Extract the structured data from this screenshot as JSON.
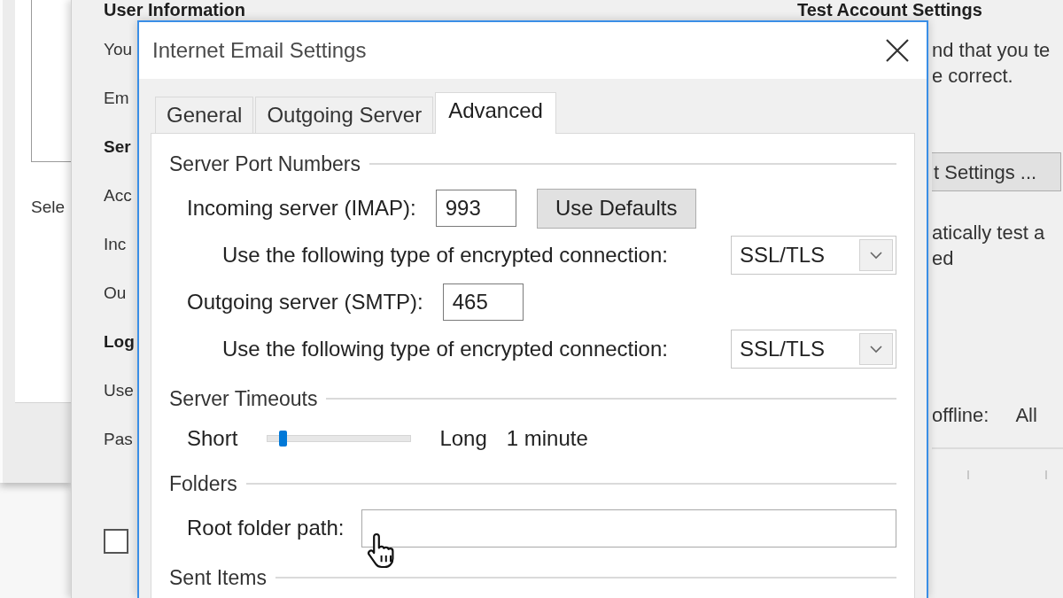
{
  "left_window": {
    "label": "Sele"
  },
  "account_window": {
    "left_column": [
      {
        "kind": "heading",
        "text": "User Information"
      },
      {
        "kind": "label",
        "text": "You"
      },
      {
        "kind": "label",
        "text": "Em"
      },
      {
        "kind": "heading",
        "text": "Ser"
      },
      {
        "kind": "label",
        "text": "Acc"
      },
      {
        "kind": "label",
        "text": "Inc"
      },
      {
        "kind": "label",
        "text": "Ou"
      },
      {
        "kind": "heading",
        "text": "Log"
      },
      {
        "kind": "label",
        "text": "Use"
      },
      {
        "kind": "label",
        "text": "Pas"
      }
    ],
    "checkbox": {
      "checked": false
    },
    "right_column": {
      "heading": "Test Account Settings",
      "lines": [
        "nd that you te",
        "e correct."
      ],
      "button": "t Settings ...",
      "note_lines": [
        "atically test a",
        "ed"
      ],
      "offline_label": "offline:",
      "offline_value": "All"
    }
  },
  "dialog": {
    "title": "Internet Email Settings",
    "tabs": [
      {
        "label": "General",
        "selected": false
      },
      {
        "label": "Outgoing Server",
        "selected": false
      },
      {
        "label": "Advanced",
        "selected": true
      }
    ],
    "sections": [
      {
        "title": "Server Port Numbers",
        "rows": [
          {
            "kind": "port",
            "label": "Incoming server (IMAP):",
            "value": "993",
            "button": "Use Defaults"
          },
          {
            "kind": "select",
            "label": "Use the following type of encrypted connection:",
            "value": "SSL/TLS"
          },
          {
            "kind": "port",
            "label": "Outgoing server (SMTP):",
            "value": "465"
          },
          {
            "kind": "select",
            "label": "Use the following type of encrypted connection:",
            "value": "SSL/TLS"
          }
        ]
      },
      {
        "title": "Server Timeouts",
        "rows": [
          {
            "kind": "slider",
            "min_label": "Short",
            "max_label": "Long",
            "level": 0.1,
            "reading": "1 minute"
          }
        ]
      },
      {
        "title": "Folders",
        "rows": [
          {
            "kind": "text",
            "label": "Root folder path:"
          }
        ]
      },
      {
        "title": "Sent Items"
      }
    ]
  }
}
